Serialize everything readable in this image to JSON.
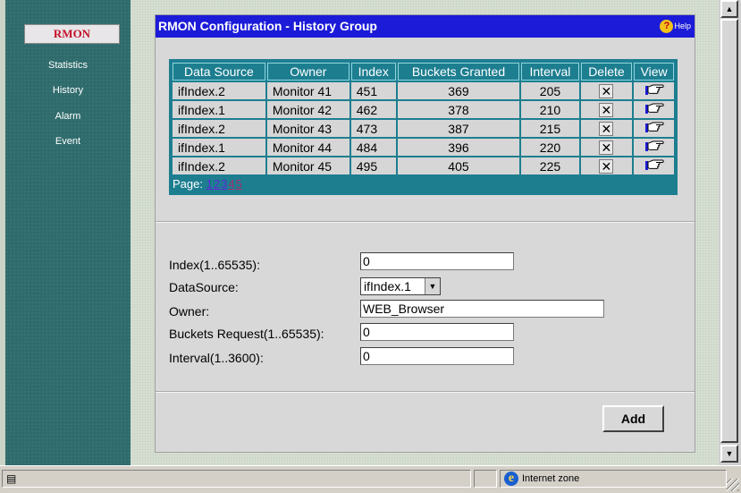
{
  "sidebar": {
    "active_tab": "RMON",
    "items": [
      {
        "label": "Statistics"
      },
      {
        "label": "History"
      },
      {
        "label": "Alarm"
      },
      {
        "label": "Event"
      }
    ]
  },
  "panel": {
    "title": "RMON Configuration - History Group",
    "help_label": "Help"
  },
  "table": {
    "headers": [
      "Data Source",
      "Owner",
      "Index",
      "Buckets Granted",
      "Interval",
      "Delete",
      "View"
    ],
    "rows": [
      {
        "data_source": "ifIndex.2",
        "owner": "Monitor 41",
        "index": "451",
        "buckets": "369",
        "interval": "205"
      },
      {
        "data_source": "ifIndex.1",
        "owner": "Monitor 42",
        "index": "462",
        "buckets": "378",
        "interval": "210"
      },
      {
        "data_source": "ifIndex.2",
        "owner": "Monitor 43",
        "index": "473",
        "buckets": "387",
        "interval": "215"
      },
      {
        "data_source": "ifIndex.1",
        "owner": "Monitor 44",
        "index": "484",
        "buckets": "396",
        "interval": "220"
      },
      {
        "data_source": "ifIndex.2",
        "owner": "Monitor 45",
        "index": "495",
        "buckets": "405",
        "interval": "225"
      }
    ],
    "delete_icon": "close-icon",
    "view_icon": "pointing-hand-icon",
    "page_label": "Page:",
    "pages": [
      "1",
      "2",
      "3",
      "4",
      "5"
    ]
  },
  "form": {
    "index_label": "Index(1..65535):",
    "index_value": "0",
    "datasource_label": "DataSource:",
    "datasource_value": "ifIndex.1",
    "owner_label": "Owner:",
    "owner_value": "WEB_Browser",
    "buckets_label": "Buckets Request(1..65535):",
    "buckets_value": "0",
    "interval_label": "Interval(1..3600):",
    "interval_value": "0",
    "add_label": "Add"
  },
  "statusbar": {
    "zone_label": "Internet zone"
  },
  "colors": {
    "sidebar_bg": "#2f6b6c",
    "titlebar_bg": "#1b1bd8",
    "table_header_bg": "#1d7e90",
    "rmon_tab_text": "#c4102a"
  }
}
